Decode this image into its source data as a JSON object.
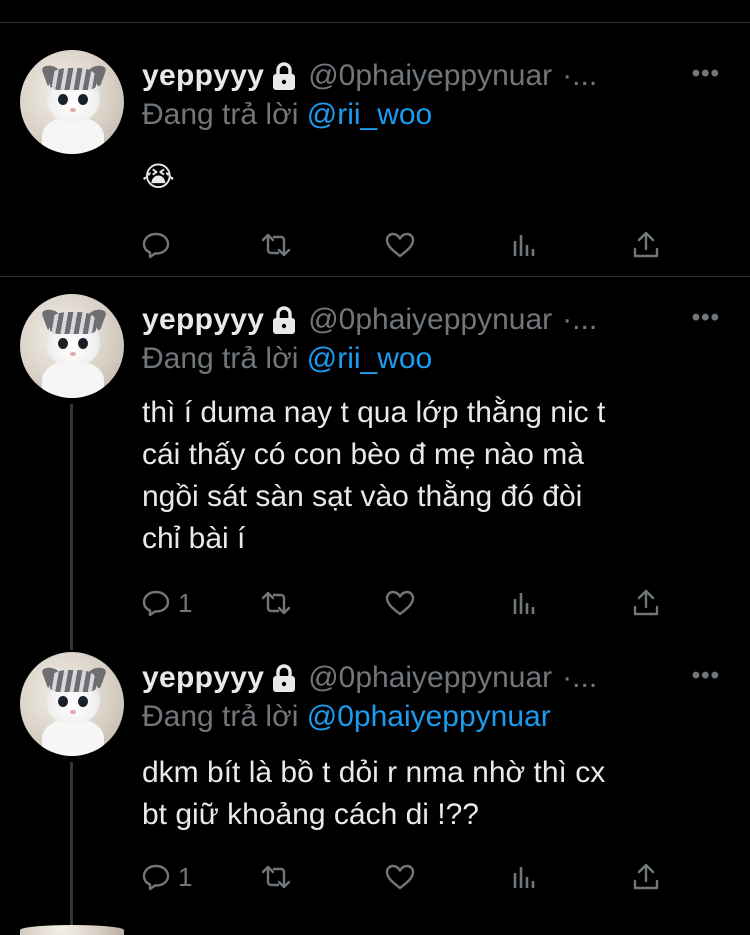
{
  "tweets": [
    {
      "name": "yeppyyy",
      "handle": "@0phaiyeppynuar",
      "time_ellipsis": "·...",
      "reply_prefix": "Đang trả lời",
      "reply_to": "@rii_woo",
      "text": "😭",
      "reply_count": "",
      "icons": [
        "reply-icon",
        "retweet-icon",
        "like-icon",
        "views-icon",
        "share-icon"
      ]
    },
    {
      "name": "yeppyyy",
      "handle": "@0phaiyeppynuar",
      "time_ellipsis": "·...",
      "reply_prefix": "Đang trả lời",
      "reply_to": "@rii_woo",
      "text_lines": [
        "thì í duma nay t qua lớp thằng nic t",
        "cái thấy có con bèo đ mẹ nào mà",
        "ngồi sát sàn sạt vào thằng đó đòi",
        "chỉ bài í"
      ],
      "reply_count": "1"
    },
    {
      "name": "yeppyyy",
      "handle": "@0phaiyeppynuar",
      "time_ellipsis": "·...",
      "reply_prefix": "Đang trả lời",
      "reply_to": "@0phaiyeppynuar",
      "text_lines": [
        "dkm bít là bồ t dỏi r nma nhờ thì cx",
        "bt giữ khoảng cách di !??"
      ],
      "reply_count": "1"
    }
  ],
  "more_menu": "•••",
  "colors": {
    "background": "#000000",
    "muted": "#71767b",
    "link": "#1d9bf0",
    "text": "#e7e9ea"
  }
}
